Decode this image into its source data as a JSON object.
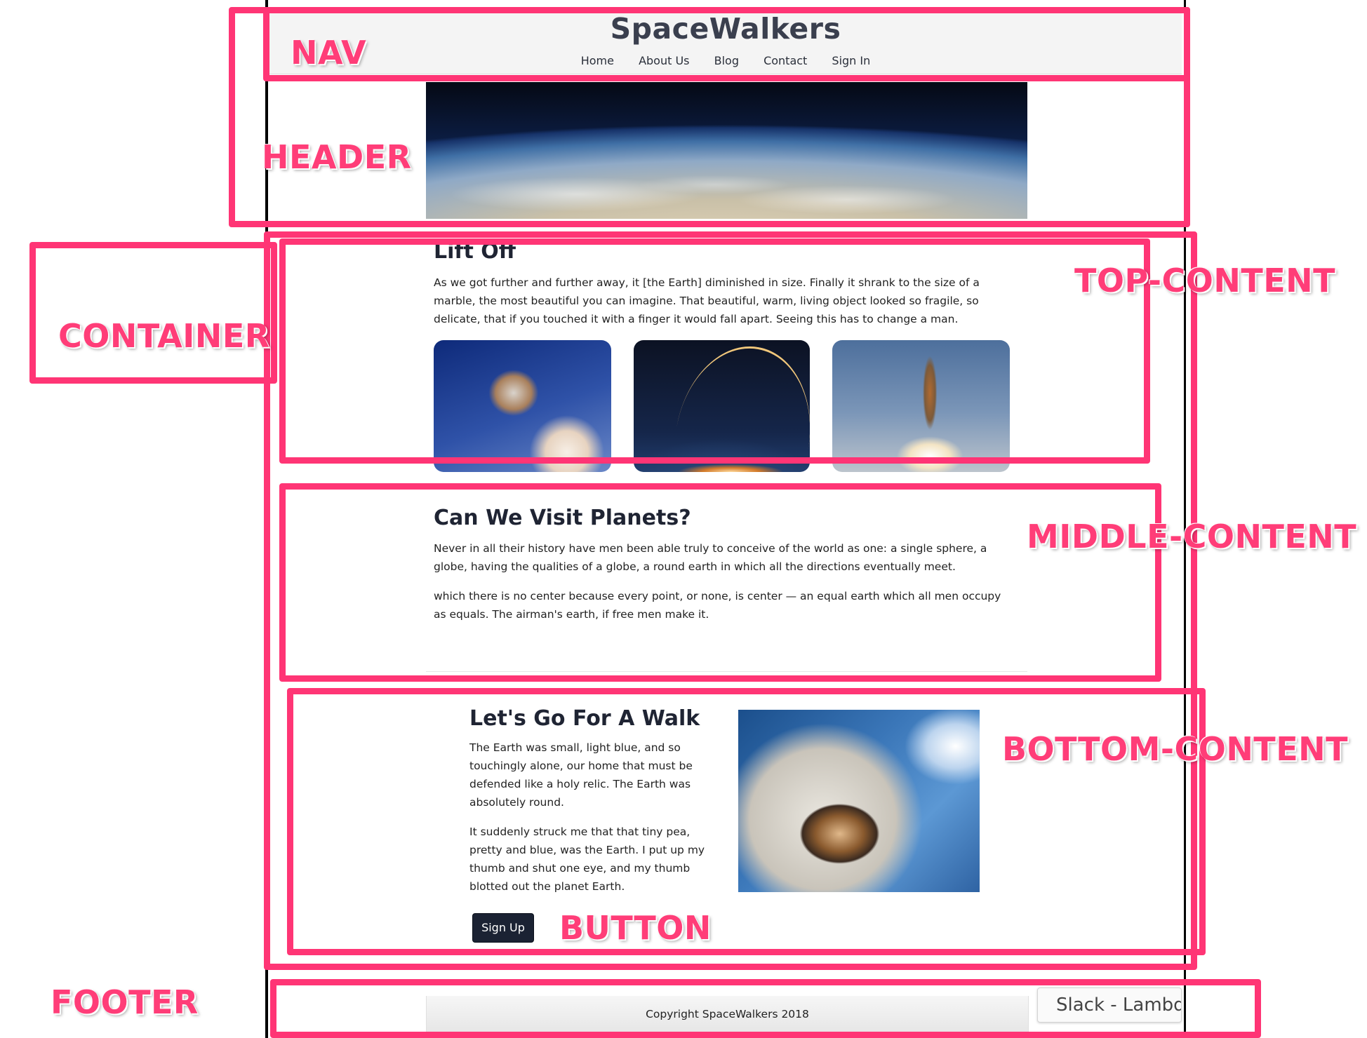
{
  "nav": {
    "brand": "SpaceWalkers",
    "links": [
      "Home",
      "About Us",
      "Blog",
      "Contact",
      "Sign In"
    ]
  },
  "top": {
    "title": "Lift Off",
    "text": "As we got further and further away, it [the Earth] diminished in size. Finally it shrank to the size of a marble, the most beautiful you can imagine. That beautiful, warm, living object looked so fragile, so delicate, that if you touched it with a finger it would fall apart. Seeing this has to change a man."
  },
  "middle": {
    "title": "Can We Visit Planets?",
    "p1": "Never in all their history have men been able truly to conceive of the world as one: a single sphere, a globe, having the qualities of a globe, a round earth in which all the directions eventually meet.",
    "p2": "which there is no center because every point, or none, is center — an equal earth which all men occupy as equals. The airman's earth, if free men make it."
  },
  "bottom": {
    "title": "Let's Go For A Walk",
    "p1": "The Earth was small, light blue, and so touchingly alone, our home that must be defended like a holy relic. The Earth was absolutely round.",
    "p2": "It suddenly struck me that that tiny pea, pretty and blue, was the Earth. I put up my thumb and shut one eye, and my thumb blotted out the planet Earth.",
    "button": "Sign Up"
  },
  "footer": {
    "text": "Copyright SpaceWalkers 2018"
  },
  "popup": {
    "text": "Slack - Lambda"
  },
  "annotations": {
    "nav": "NAV",
    "header": "HEADER",
    "container": "CONTAINER",
    "top": "TOP-CONTENT",
    "middle": "MIDDLE-CONTENT",
    "bottom": "BOTTOM-CONTENT",
    "button": "BUTTON",
    "footer": "FOOTER"
  },
  "colors": {
    "annotation": "#ff3575",
    "button_bg": "#1b2233",
    "heading": "#1f2433"
  }
}
